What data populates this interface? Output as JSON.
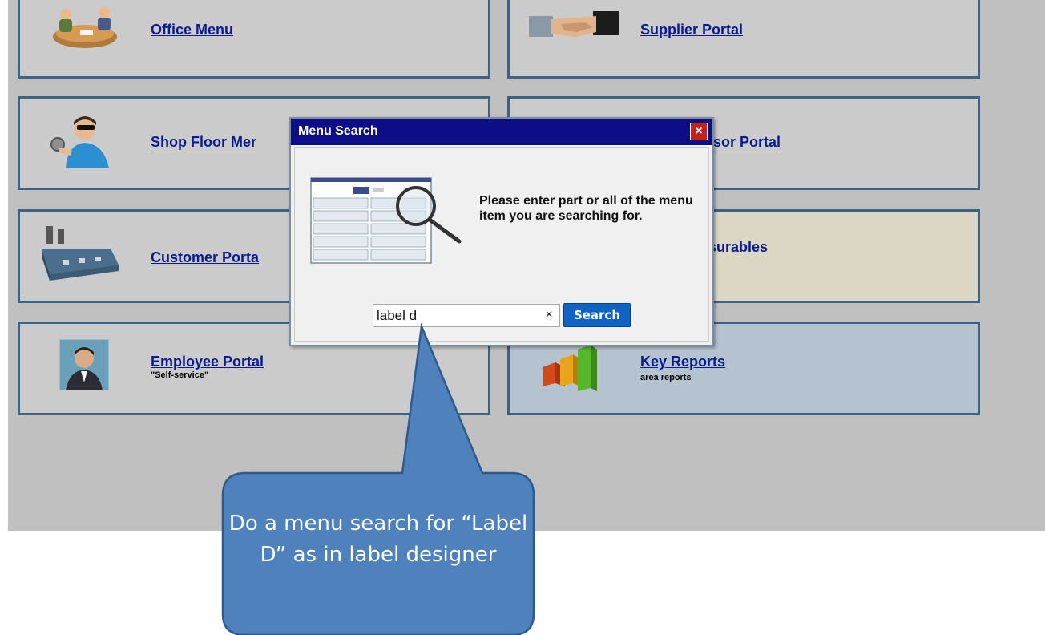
{
  "tiles": {
    "office": {
      "label": "Office Menu"
    },
    "supplier": {
      "label": "Supplier Portal"
    },
    "shopfloor": {
      "label": "Shop Floor Mer"
    },
    "supervisor": {
      "label": "sor Portal"
    },
    "customer": {
      "label": "Customer Porta"
    },
    "measurables": {
      "label": "surables"
    },
    "employee": {
      "label": "Employee Portal",
      "sub": "\"Self-service\""
    },
    "reports": {
      "label": "Key Reports",
      "sub": "area reports"
    }
  },
  "dialog": {
    "title": "Menu Search",
    "close_label": "×",
    "message": "Please enter part or all of the menu item you are searching for.",
    "search_value": "label d",
    "clear_label": "×",
    "search_label": "Search"
  },
  "callout": {
    "text": "Do a menu search for “Label D” as in label designer"
  },
  "colors": {
    "title_bar": "#0d0d88",
    "tile_border": "#3d6282",
    "callout_fill": "#4f81bd",
    "search_button": "#1063c2"
  }
}
